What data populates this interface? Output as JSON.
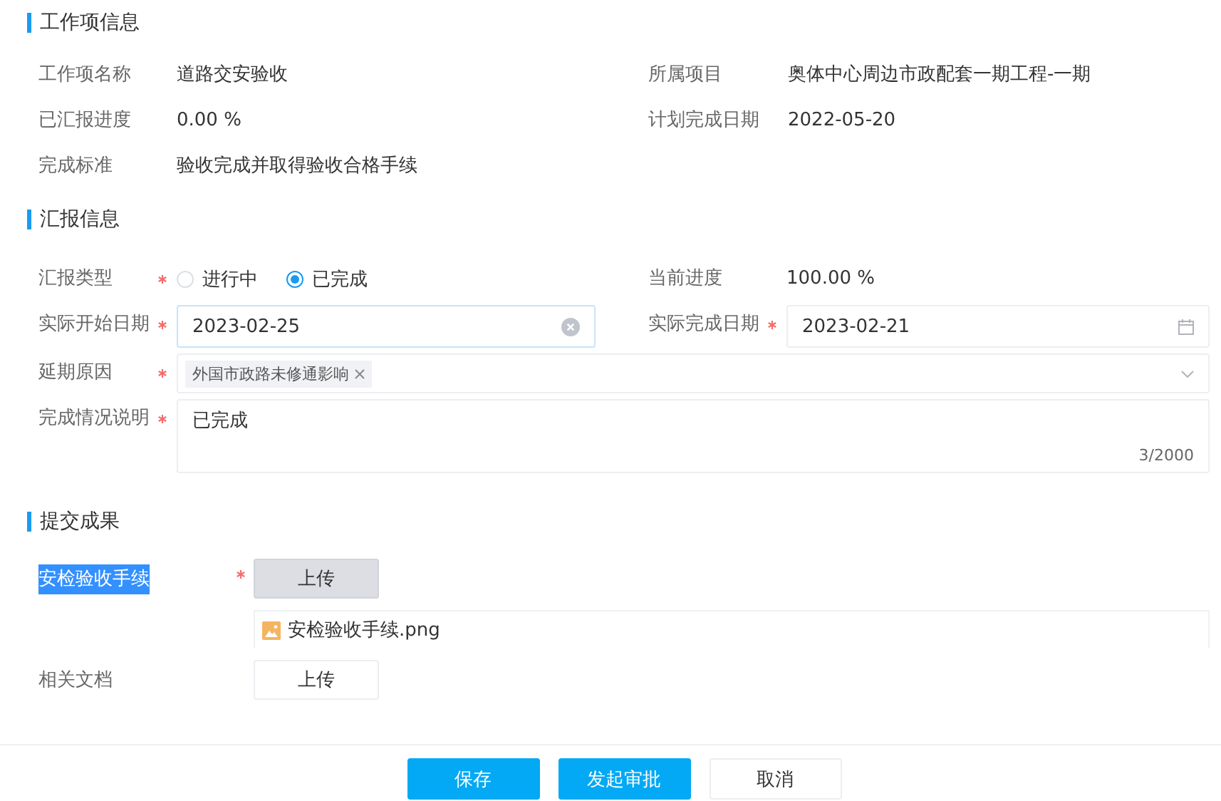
{
  "work_item": {
    "title": "工作项信息",
    "fields": [
      {
        "label": "工作项名称",
        "value": "道路交安验收"
      },
      {
        "label": "所属项目",
        "value": "奥体中心周边市政配套一期工程-一期"
      },
      {
        "label": "已汇报进度",
        "value": "0.00 %"
      },
      {
        "label": "计划完成日期",
        "value": "2022-05-20"
      },
      {
        "label": "完成标准",
        "value": "验收完成并取得验收合格手续"
      }
    ]
  },
  "report": {
    "title": "汇报信息",
    "rows": [
      [
        {
          "kind": "radio",
          "label": "汇报类型",
          "required": true,
          "options": [
            {
              "label": "进行中",
              "selected": false
            },
            {
              "label": "已完成",
              "selected": true
            }
          ]
        },
        {
          "kind": "text",
          "label": "当前进度",
          "required": false,
          "value": "100.00 %"
        }
      ],
      [
        {
          "kind": "date",
          "label": "实际开始日期",
          "required": true,
          "value": "2023-02-25",
          "focused": true
        },
        {
          "kind": "date",
          "label": "实际完成日期",
          "required": true,
          "value": "2023-02-21",
          "focused": false
        }
      ],
      [
        {
          "kind": "tags",
          "label": "延期原因",
          "required": true,
          "tags": [
            "外国市政路未修通影响"
          ]
        }
      ],
      [
        {
          "kind": "textarea",
          "label": "完成情况说明",
          "required": true,
          "value": "已完成",
          "counter": "3/2000"
        }
      ]
    ]
  },
  "results": {
    "title": "提交成果",
    "items": [
      {
        "label": "安检验收手续",
        "highlighted": true,
        "required": true,
        "button": "上传",
        "hovered": true,
        "files": [
          "安检验收手续.png"
        ]
      },
      {
        "label": "相关文档",
        "highlighted": false,
        "required": false,
        "button": "上传",
        "hovered": false
      }
    ]
  },
  "footer_buttons": [
    {
      "label": "保存",
      "kind": "primary"
    },
    {
      "label": "发起审批",
      "kind": "primary"
    },
    {
      "label": "取消",
      "kind": "default"
    }
  ]
}
